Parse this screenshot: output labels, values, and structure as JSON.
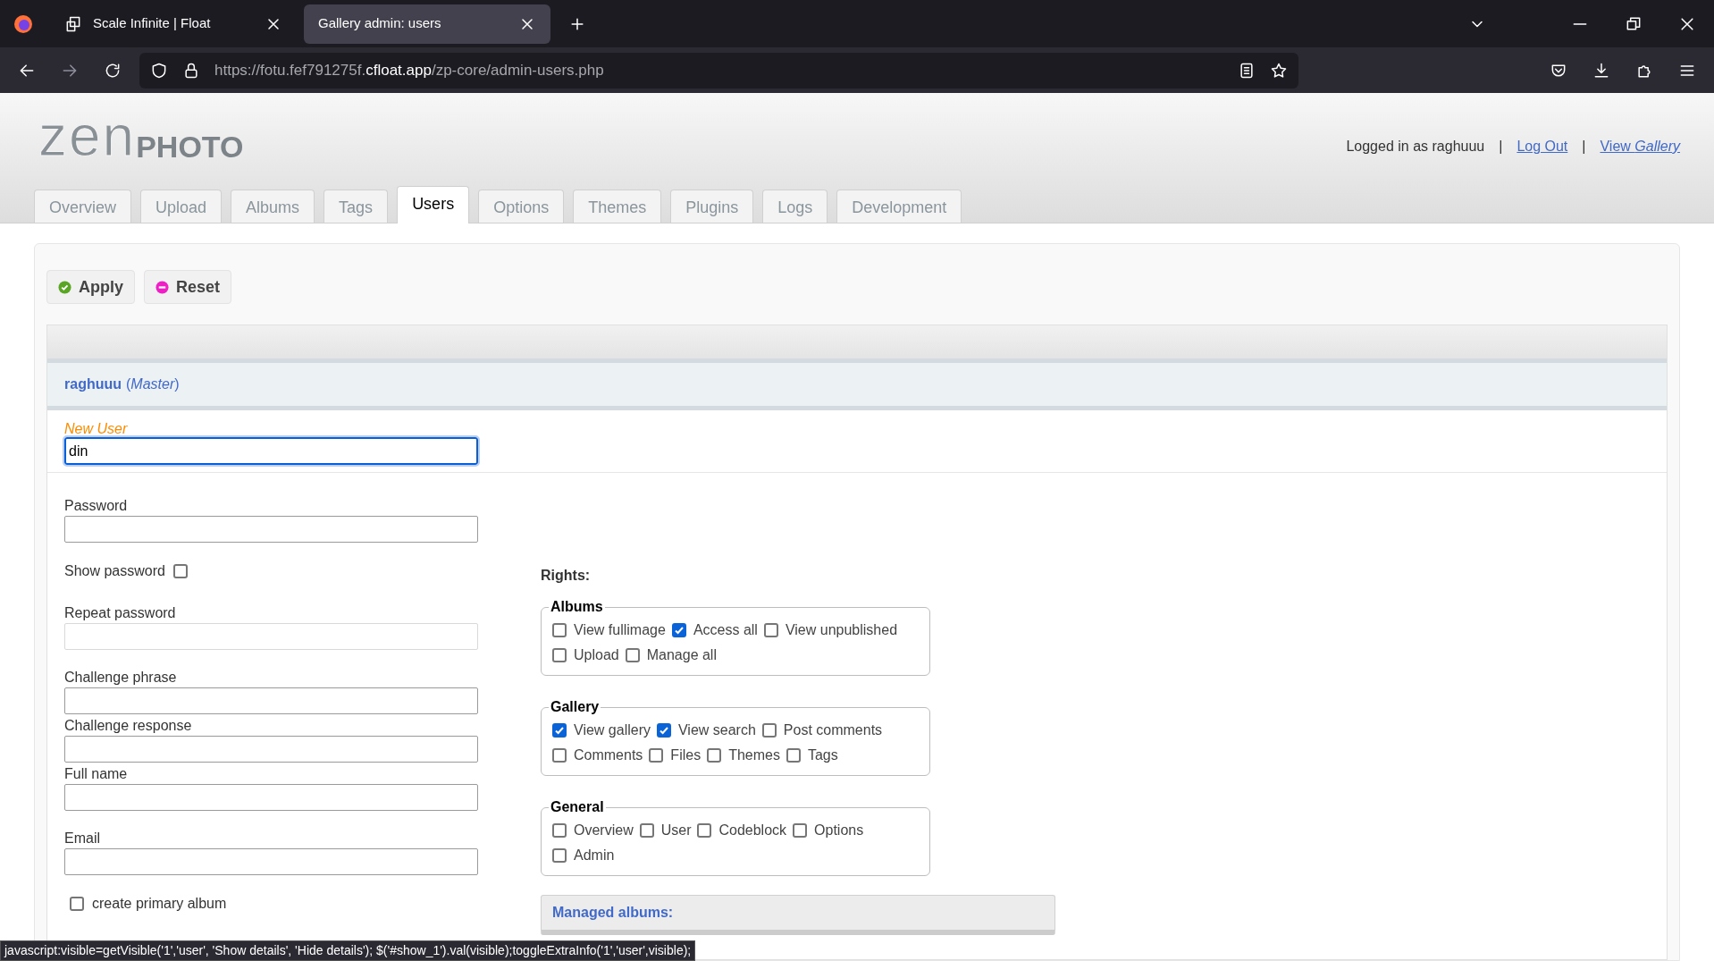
{
  "browser": {
    "tabs": [
      {
        "title": "Scale Infinite | Float",
        "selected": false
      },
      {
        "title": "Gallery admin: users",
        "selected": true
      }
    ],
    "url": {
      "prefix": "https://fotu.fef791275f.",
      "domain": "cfloat.app",
      "path": "/zp-core/admin-users.php"
    }
  },
  "header": {
    "logo": {
      "light": "zen",
      "bold": "PHOTO"
    },
    "logged_in": "Logged in as raghuuu",
    "separators": [
      "|",
      "|"
    ],
    "links": [
      "Log Out",
      "View *Gallery*"
    ]
  },
  "nav_tabs": [
    {
      "label": "Overview",
      "selected": false
    },
    {
      "label": "Upload",
      "selected": false
    },
    {
      "label": "Albums",
      "selected": false
    },
    {
      "label": "Tags",
      "selected": false
    },
    {
      "label": "Users",
      "selected": true
    },
    {
      "label": "Options",
      "selected": false
    },
    {
      "label": "Themes",
      "selected": false
    },
    {
      "label": "Plugins",
      "selected": false
    },
    {
      "label": "Logs",
      "selected": false
    },
    {
      "label": "Development",
      "selected": false
    }
  ],
  "buttons": [
    {
      "label": "Apply",
      "kind": "apply"
    },
    {
      "label": "Reset",
      "kind": "reset"
    }
  ],
  "user_header": {
    "name": "raghuuu",
    "role": "(*Master*)"
  },
  "new_user": {
    "label": "New User",
    "value": "din"
  },
  "fields": [
    {
      "kind": "input",
      "label": "Password",
      "disabled": false
    },
    {
      "kind": "checkbox",
      "label": "Show password",
      "checked": false
    },
    {
      "kind": "input",
      "label": "Repeat password",
      "disabled": true
    },
    {
      "kind": "input",
      "label": "Challenge phrase",
      "disabled": false
    },
    {
      "kind": "input",
      "label": "Challenge response",
      "disabled": false
    },
    {
      "kind": "input",
      "label": "Full name",
      "disabled": false
    },
    {
      "kind": "input",
      "label": "Email",
      "disabled": false
    },
    {
      "kind": "checkbox",
      "label": "create primary album",
      "checked": false
    }
  ],
  "rights": {
    "title": "Rights:",
    "groups": [
      {
        "title": "Albums",
        "items": [
          {
            "label": "View fullimage",
            "checked": false
          },
          {
            "label": "Access all",
            "checked": true
          },
          {
            "label": "View unpublished",
            "checked": false
          },
          {
            "label": "Upload",
            "checked": false
          },
          {
            "label": "Manage all",
            "checked": false
          }
        ]
      },
      {
        "title": "Gallery",
        "items": [
          {
            "label": "View gallery",
            "checked": true
          },
          {
            "label": "View search",
            "checked": true
          },
          {
            "label": "Post comments",
            "checked": false
          },
          {
            "label": "Comments",
            "checked": false
          },
          {
            "label": "Files",
            "checked": false
          },
          {
            "label": "Themes",
            "checked": false
          },
          {
            "label": "Tags",
            "checked": false
          }
        ]
      },
      {
        "title": "General",
        "items": [
          {
            "label": "Overview",
            "checked": false
          },
          {
            "label": "User",
            "checked": false
          },
          {
            "label": "Codeblock",
            "checked": false
          },
          {
            "label": "Options",
            "checked": false
          },
          {
            "label": "Admin",
            "checked": false
          }
        ]
      }
    ]
  },
  "managed_albums": {
    "title": "Managed albums:"
  },
  "status_bar": "javascript:visible=getVisible('1','user', 'Show details', 'Hide details'); $('#show_1').val(visible);toggleExtraInfo('1','user',visible);"
}
